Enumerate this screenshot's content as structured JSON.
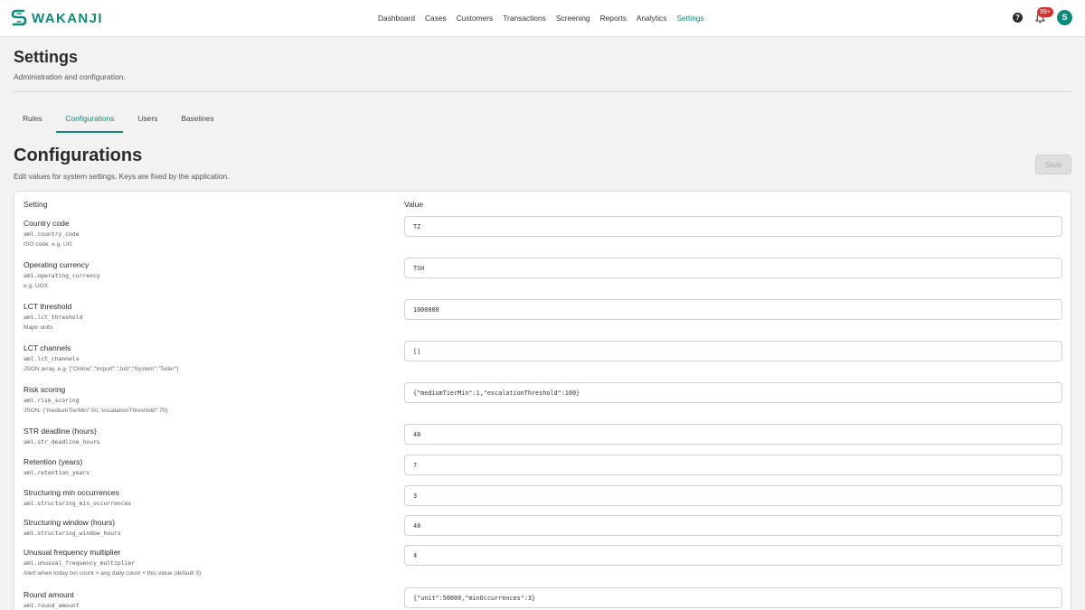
{
  "app": {
    "name": "WAKANJI"
  },
  "nav": {
    "items": [
      {
        "label": "Dashboard"
      },
      {
        "label": "Cases"
      },
      {
        "label": "Customers"
      },
      {
        "label": "Transactions"
      },
      {
        "label": "Screening"
      },
      {
        "label": "Reports"
      },
      {
        "label": "Analytics"
      },
      {
        "label": "Settings",
        "active": true
      }
    ]
  },
  "header": {
    "help_icon": "question-circle-icon",
    "notifications": {
      "icon": "bell-icon",
      "count": "99+"
    },
    "avatar": "S"
  },
  "page": {
    "title": "Settings",
    "subtitle": "Administration and configuration."
  },
  "tabs": [
    {
      "label": "Rules"
    },
    {
      "label": "Configurations",
      "active": true
    },
    {
      "label": "Users"
    },
    {
      "label": "Baselines"
    }
  ],
  "section": {
    "title": "Configurations",
    "description": "Edit values for system settings. Keys are fixed by the application.",
    "save_label": "Save"
  },
  "table": {
    "columns": {
      "setting": "Setting",
      "value": "Value"
    },
    "rows": [
      {
        "label": "Country code",
        "key": "aml.country_code",
        "hint": "ISO code, e.g. UG",
        "value": "TZ"
      },
      {
        "label": "Operating currency",
        "key": "aml.operating_currency",
        "hint": "e.g. UGX",
        "value": "TSH"
      },
      {
        "label": "LCT threshold",
        "key": "aml.lct_threshold",
        "hint": "Major units",
        "value": "1000000"
      },
      {
        "label": "LCT channels",
        "key": "aml.lct_channels",
        "hint": "JSON array, e.g. [\"Online\",\"Import\",\"Job\",\"System\",\"Teller\"]",
        "value": "[]"
      },
      {
        "label": "Risk scoring",
        "key": "aml.risk_scoring",
        "hint": "JSON: {\"mediumTierMin\":50,\"escalationThreshold\":70}",
        "value": "{\"mediumTierMin\":1,\"escalationThreshold\":100}"
      },
      {
        "label": "STR deadline (hours)",
        "key": "aml.str_deadline_hours",
        "hint": "",
        "value": "48"
      },
      {
        "label": "Retention (years)",
        "key": "aml.retention_years",
        "hint": "",
        "value": "7"
      },
      {
        "label": "Structuring min occurrences",
        "key": "aml.structuring_min_occurrences",
        "hint": "",
        "value": "3"
      },
      {
        "label": "Structuring window (hours)",
        "key": "aml.structuring_window_hours",
        "hint": "",
        "value": "48"
      },
      {
        "label": "Unusual frequency multiplier",
        "key": "aml.unusual_frequency_multiplier",
        "hint": "Alert when today txn count > avg daily count × this value (default 3)",
        "value": "4"
      },
      {
        "label": "Round amount",
        "key": "aml.round_amount",
        "hint": "",
        "value": "{\"unit\":50000,\"minOccurrences\":3}"
      }
    ]
  }
}
